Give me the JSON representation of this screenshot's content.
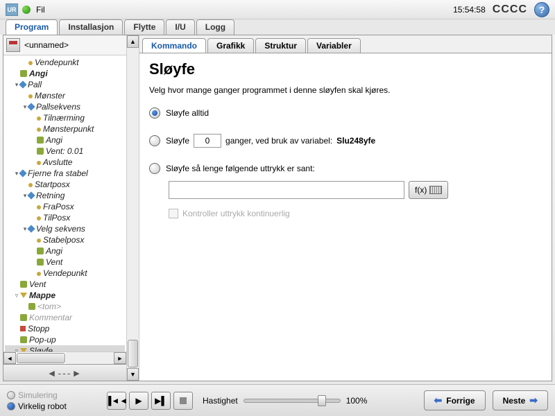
{
  "topbar": {
    "logo": "UR",
    "menu_file": "Fil",
    "clock": "15:54:58",
    "cccc": "CCCC"
  },
  "maintabs": {
    "program": "Program",
    "install": "Installasjon",
    "move": "Flytte",
    "io": "I/U",
    "log": "Logg"
  },
  "filebar": {
    "name": "<unnamed>"
  },
  "tree": [
    {
      "d": 2,
      "i": "dot",
      "l": "Vendepunkt"
    },
    {
      "d": 1,
      "i": "cmd",
      "l": "Angi",
      "b": true
    },
    {
      "d": 1,
      "i": "str",
      "l": "Pall",
      "t": "▾"
    },
    {
      "d": 2,
      "i": "dot",
      "l": "Mønster"
    },
    {
      "d": 2,
      "i": "str",
      "l": "Pallsekvens",
      "t": "▾"
    },
    {
      "d": 3,
      "i": "dot",
      "l": "Tilnærming"
    },
    {
      "d": 3,
      "i": "dot",
      "l": "Mønsterpunkt"
    },
    {
      "d": 3,
      "i": "cmd",
      "l": "Angi"
    },
    {
      "d": 3,
      "i": "cmd",
      "l": "Vent: 0.01"
    },
    {
      "d": 3,
      "i": "dot",
      "l": "Avslutte"
    },
    {
      "d": 1,
      "i": "str",
      "l": "Fjerne fra stabel",
      "t": "▾"
    },
    {
      "d": 2,
      "i": "dot",
      "l": "Startposx"
    },
    {
      "d": 2,
      "i": "str",
      "l": "Retning",
      "t": "▾"
    },
    {
      "d": 3,
      "i": "dot",
      "l": "FraPosx"
    },
    {
      "d": 3,
      "i": "dot",
      "l": "TilPosx"
    },
    {
      "d": 2,
      "i": "str",
      "l": "Velg sekvens",
      "t": "▾"
    },
    {
      "d": 3,
      "i": "dot",
      "l": "Stabelposx"
    },
    {
      "d": 3,
      "i": "cmd",
      "l": "Angi"
    },
    {
      "d": 3,
      "i": "cmd",
      "l": "Vent"
    },
    {
      "d": 3,
      "i": "dot",
      "l": "Vendepunkt"
    },
    {
      "d": 1,
      "i": "cmd",
      "l": "Vent"
    },
    {
      "d": 1,
      "i": "folder",
      "l": "Mappe",
      "b": true,
      "t": "▿"
    },
    {
      "d": 2,
      "i": "cmd",
      "l": "<tom>",
      "g": true
    },
    {
      "d": 1,
      "i": "cmd",
      "l": "Kommentar",
      "g": true
    },
    {
      "d": 1,
      "i": "stop",
      "l": "Stopp"
    },
    {
      "d": 1,
      "i": "cmd",
      "l": "Pop-up"
    },
    {
      "d": 1,
      "i": "folder",
      "l": "Sløyfe",
      "sel": true,
      "t": "▿"
    }
  ],
  "nav_arrows": "◄---►",
  "subtabs": {
    "cmd": "Kommando",
    "gfx": "Grafikk",
    "struct": "Struktur",
    "vars": "Variabler"
  },
  "panel": {
    "title": "Sløyfe",
    "desc": "Velg hvor mange ganger programmet i denne sløyfen skal kjøres.",
    "opt_always": "Sløyfe alltid",
    "opt_count_pre": "Sløyfe",
    "opt_count_val": "0",
    "opt_count_post": "ganger, ved bruk av variabel:",
    "opt_count_var": "Slu248yfe",
    "opt_expr": "Sløyfe så lenge følgende uttrykk er sant:",
    "fx": "f(x)",
    "chk": "Kontroller uttrykk kontinuerlig"
  },
  "footer": {
    "sim": "Simulering",
    "real": "Virkelig robot",
    "speed_label": "Hastighet",
    "speed_val": "100%",
    "prev": "Forrige",
    "next": "Neste"
  }
}
